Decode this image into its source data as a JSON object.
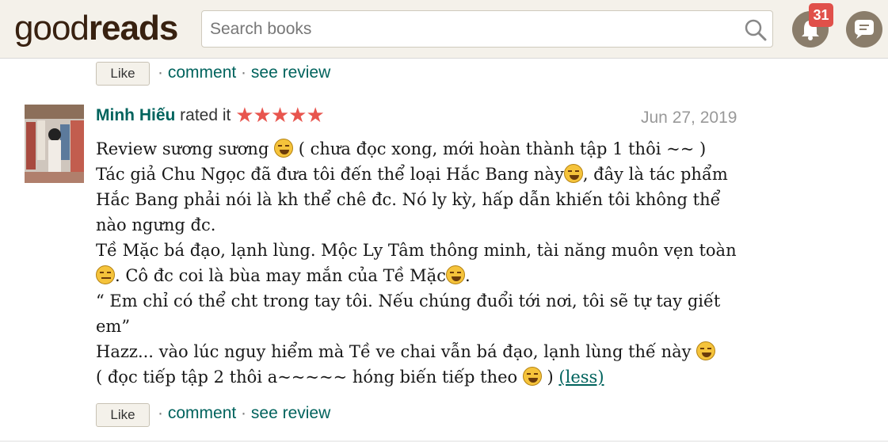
{
  "header": {
    "logo_good": "good",
    "logo_reads": "reads",
    "search_placeholder": "Search books",
    "notification_count": "31"
  },
  "prev_review_actions": {
    "like_label": "Like",
    "sep1": "·",
    "comment_label": "comment",
    "sep2": "·",
    "see_review_label": "see review"
  },
  "review": {
    "reviewer": "Minh Hiếu",
    "rated_text": "rated it",
    "stars": "★★★★★",
    "rating": 5,
    "date": "Jun 27, 2019",
    "lines": {
      "l1a": "Review sương sương ",
      "l1b": " ( chưa đọc xong, mới hoàn thành tập 1 thôi ~~ )",
      "l2a": "Tác giả Chu Ngọc đã đưa tôi đến thể loại Hắc Bang này",
      "l2b": ", đây là tác phẩm Hắc Bang phải nói là kh thể chê đc. Nó ly kỳ, hấp dẫn khiến tôi không thể nào ngưng đc.",
      "l3a": "Tề Mặc bá đạo, lạnh lùng. Mộc Ly Tâm thông minh, tài năng muôn vẹn toàn ",
      "l3b": ". Cô đc coi là bùa may mắn của Tề Mặc",
      "l3c": ".",
      "l4": "“ Em chỉ có thể cht trong tay tôi. Nếu chúng đuổi tới nơi, tôi sẽ tự tay giết em”",
      "l5a": "Hazz... vào lúc nguy hiểm mà Tề ve chai vẫn bá đạo, lạnh lùng thế này ",
      "l6a": "( đọc tiếp tập 2 thôi a~~~~~ hóng biến tiếp theo ",
      "l6b": " ) ",
      "less_label": "(less)"
    },
    "actions": {
      "like_label": "Like",
      "sep1": "·",
      "comment_label": "comment",
      "sep2": "·",
      "see_review_label": "see review"
    }
  },
  "colors": {
    "header_bg": "#f4f1ea",
    "link": "#00635d",
    "star": "#e8554e",
    "badge": "#e0504a"
  }
}
